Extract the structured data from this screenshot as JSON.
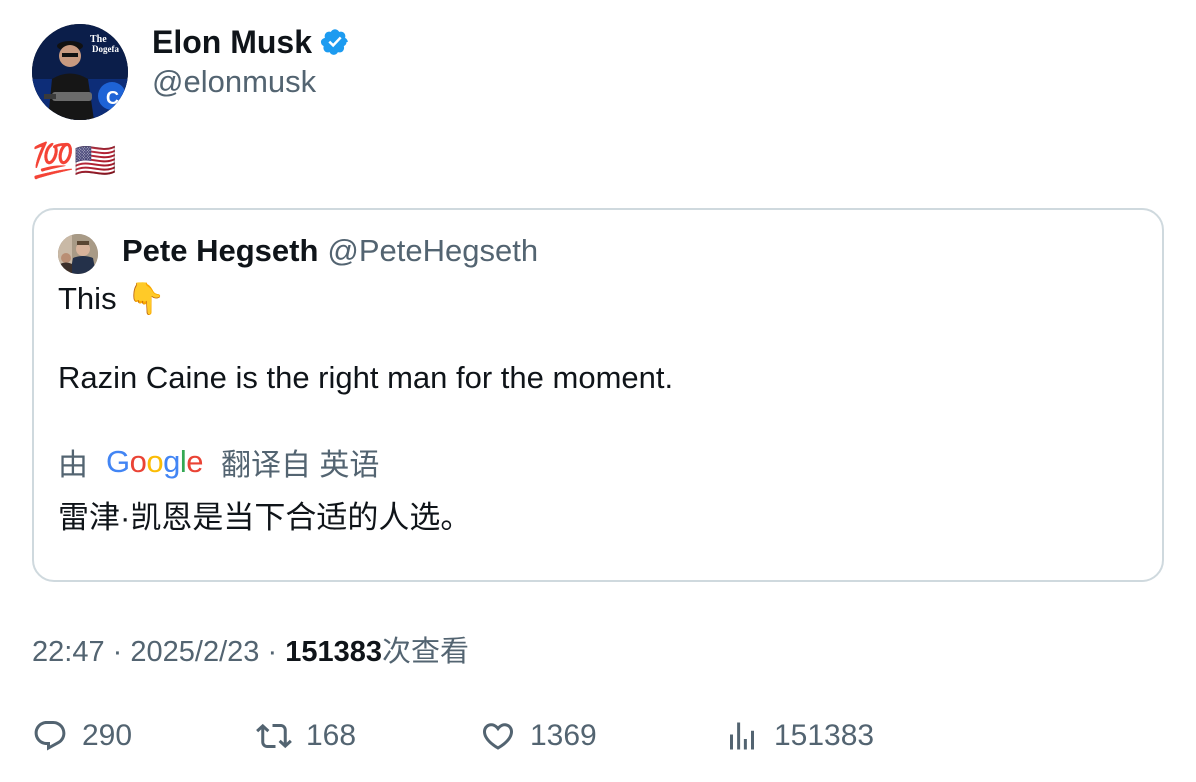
{
  "author": {
    "display_name": "Elon Musk",
    "handle": "@elonmusk",
    "avatar_icon": "elon-musk-avatar",
    "verified_icon": "verified-badge-icon",
    "verified_color": "#1d9bf0"
  },
  "tweet": {
    "text_emojis": "💯🇺🇸"
  },
  "quote": {
    "display_name": "Pete Hegseth",
    "handle": "@PeteHegseth",
    "line1_text": "This",
    "line1_emoji": "👇",
    "line2_text": "Razin Caine is the right man for the moment.",
    "translate_prefix": "由",
    "translate_provider": "Google",
    "translate_suffix": "翻译自 英语",
    "translated_text": "雷津·凯恩是当下合适的人选。"
  },
  "meta": {
    "time": "22:47",
    "separator": "·",
    "date": "2025/2/23",
    "views_count": "151383",
    "views_label": "次查看"
  },
  "actions": {
    "replies": "290",
    "retweets": "168",
    "likes": "1369",
    "views": "151383"
  },
  "colors": {
    "text": "#0f1419",
    "muted": "#536471",
    "border": "#cfd9de",
    "google_blue": "#4285F4",
    "google_red": "#EA4335",
    "google_yellow": "#FBBC05",
    "google_green": "#34A853"
  }
}
